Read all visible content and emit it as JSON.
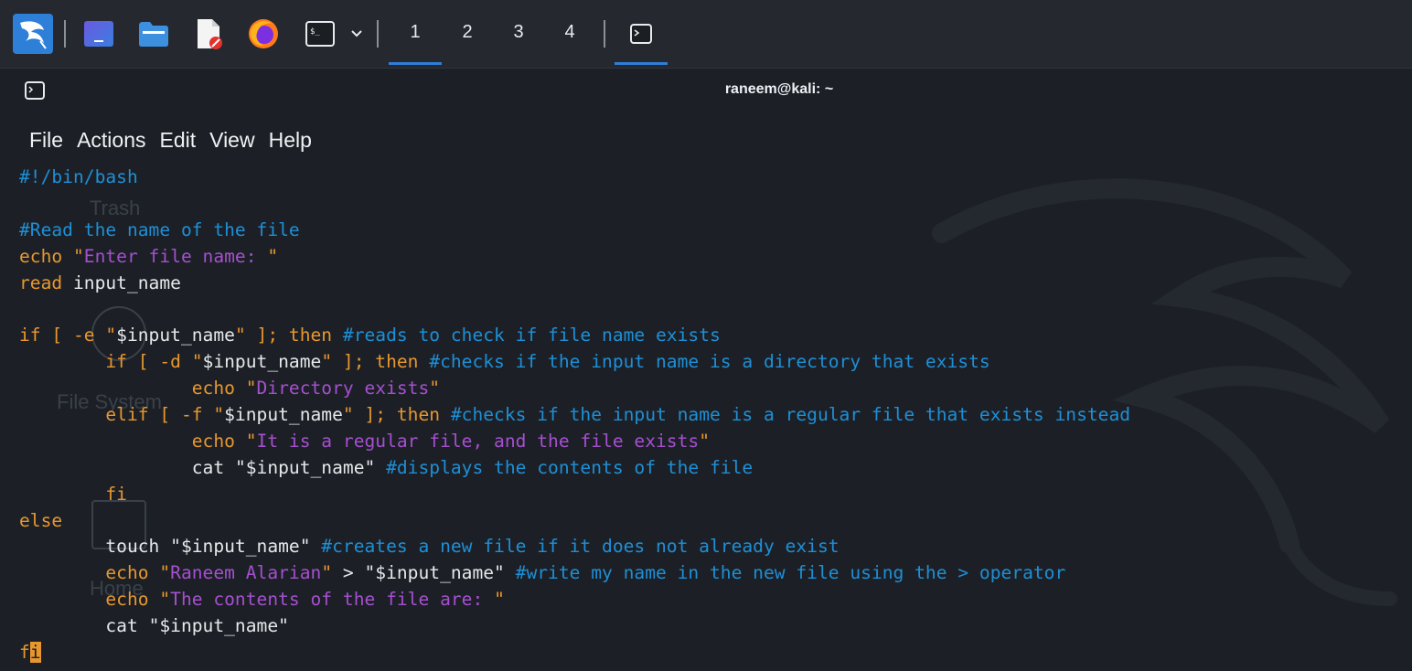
{
  "taskbar": {
    "workspaces": [
      "1",
      "2",
      "3",
      "4"
    ],
    "active_workspace": "1",
    "accent": "#2f7ed8"
  },
  "window": {
    "title": "raneem@kali: ~"
  },
  "menu": [
    "File",
    "Actions",
    "Edit",
    "View",
    "Help"
  ],
  "desktop_icons": [
    "Trash",
    "File System",
    "Home"
  ],
  "editor": {
    "lines": [
      [
        {
          "t": "#!/bin/bash",
          "c": "comment"
        }
      ],
      [],
      [
        {
          "t": "#Read the name of the file",
          "c": "comment"
        }
      ],
      [
        {
          "t": "echo ",
          "c": "kw"
        },
        {
          "t": "\"",
          "c": "q"
        },
        {
          "t": "Enter file name: ",
          "c": "str"
        },
        {
          "t": "\"",
          "c": "q"
        }
      ],
      [
        {
          "t": "read ",
          "c": "kw"
        },
        {
          "t": "input_name",
          "c": "plain"
        }
      ],
      [],
      [
        {
          "t": "if ",
          "c": "kw"
        },
        {
          "t": "[ -e ",
          "c": "kw"
        },
        {
          "t": "\"",
          "c": "q"
        },
        {
          "t": "$input_name",
          "c": "plain"
        },
        {
          "t": "\"",
          "c": "q"
        },
        {
          "t": " ]; then ",
          "c": "kw"
        },
        {
          "t": "#reads to check if file name exists",
          "c": "comment"
        }
      ],
      [
        {
          "t": "        if ",
          "c": "kw"
        },
        {
          "t": "[ -d ",
          "c": "kw"
        },
        {
          "t": "\"",
          "c": "q"
        },
        {
          "t": "$input_name",
          "c": "plain"
        },
        {
          "t": "\"",
          "c": "q"
        },
        {
          "t": " ]; then ",
          "c": "kw"
        },
        {
          "t": "#checks if the input name is a directory that exists",
          "c": "comment"
        }
      ],
      [
        {
          "t": "                echo ",
          "c": "kw"
        },
        {
          "t": "\"",
          "c": "q"
        },
        {
          "t": "Directory exists",
          "c": "str"
        },
        {
          "t": "\"",
          "c": "q"
        }
      ],
      [
        {
          "t": "        elif ",
          "c": "kw"
        },
        {
          "t": "[ -f ",
          "c": "kw"
        },
        {
          "t": "\"",
          "c": "q"
        },
        {
          "t": "$input_name",
          "c": "plain"
        },
        {
          "t": "\"",
          "c": "q"
        },
        {
          "t": " ]; then ",
          "c": "kw"
        },
        {
          "t": "#checks if the input name is a regular file that exists instead",
          "c": "comment"
        }
      ],
      [
        {
          "t": "                echo ",
          "c": "kw"
        },
        {
          "t": "\"",
          "c": "q"
        },
        {
          "t": "It is a regular file, and the file exists",
          "c": "str"
        },
        {
          "t": "\"",
          "c": "q"
        }
      ],
      [
        {
          "t": "                cat ",
          "c": "plain"
        },
        {
          "t": "\"$input_name\"",
          "c": "plain"
        },
        {
          "t": " #displays the contents of the file",
          "c": "comment"
        }
      ],
      [
        {
          "t": "        fi",
          "c": "kw"
        }
      ],
      [
        {
          "t": "else",
          "c": "kw"
        }
      ],
      [
        {
          "t": "        touch ",
          "c": "plain"
        },
        {
          "t": "\"$input_name\"",
          "c": "plain"
        },
        {
          "t": " #creates a new file if it does not already exist",
          "c": "comment"
        }
      ],
      [
        {
          "t": "        echo ",
          "c": "kw"
        },
        {
          "t": "\"",
          "c": "q"
        },
        {
          "t": "Raneem Alarian",
          "c": "str"
        },
        {
          "t": "\"",
          "c": "q"
        },
        {
          "t": " > ",
          "c": "plain"
        },
        {
          "t": "\"$input_name\"",
          "c": "plain"
        },
        {
          "t": " #write my name in the new file using the > operator",
          "c": "comment"
        }
      ],
      [
        {
          "t": "        echo ",
          "c": "kw"
        },
        {
          "t": "\"",
          "c": "q"
        },
        {
          "t": "The contents of the file are: ",
          "c": "str"
        },
        {
          "t": "\"",
          "c": "q"
        }
      ],
      [
        {
          "t": "        cat ",
          "c": "plain"
        },
        {
          "t": "\"$input_name\"",
          "c": "plain"
        }
      ],
      [
        {
          "t": "f",
          "c": "kw"
        },
        {
          "t": "i",
          "c": "cursor"
        }
      ]
    ]
  }
}
